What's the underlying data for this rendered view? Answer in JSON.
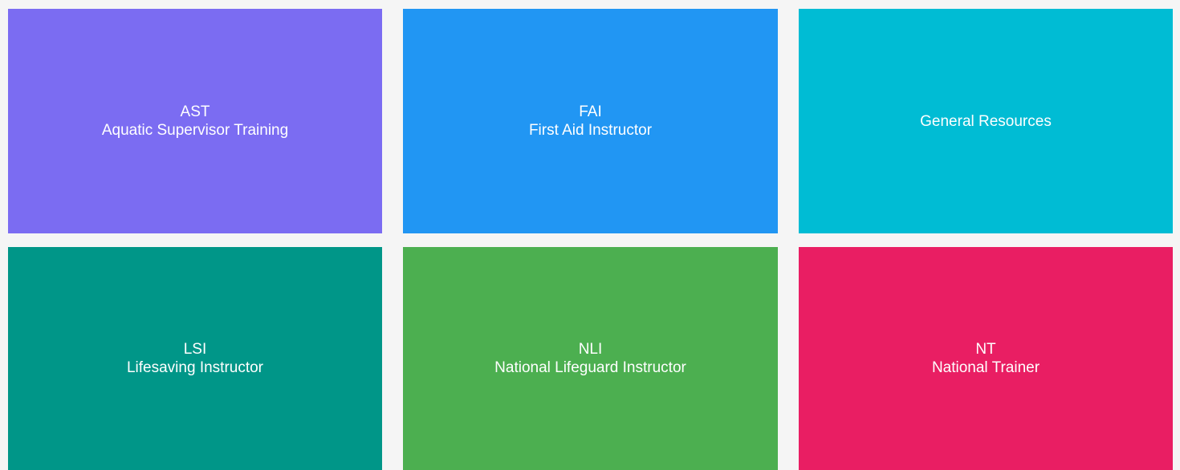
{
  "tiles": [
    {
      "code": "AST",
      "title": "Aquatic Supervisor Training",
      "color": "#7b6cf2"
    },
    {
      "code": "FAI",
      "title": "First Aid Instructor",
      "color": "#2196f3"
    },
    {
      "code": "",
      "title": "General Resources",
      "color": "#00bcd4"
    },
    {
      "code": "LSI",
      "title": "Lifesaving Instructor",
      "color": "#009688"
    },
    {
      "code": "NLI",
      "title": "National Lifeguard Instructor",
      "color": "#4caf50"
    },
    {
      "code": "NT",
      "title": "National Trainer",
      "color": "#e91e63"
    }
  ]
}
